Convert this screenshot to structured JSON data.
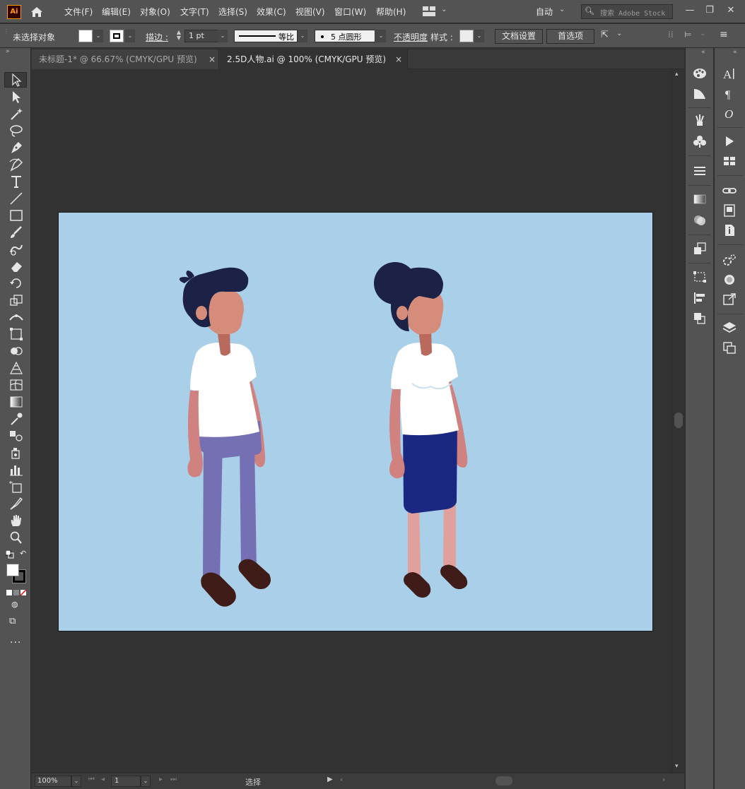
{
  "app": {
    "logo_text": "Ai",
    "menu": [
      "文件(F)",
      "编辑(E)",
      "对象(O)",
      "文字(T)",
      "选择(S)",
      "效果(C)",
      "视图(V)",
      "窗口(W)",
      "帮助(H)"
    ],
    "workspace": "自动",
    "search_placeholder": "搜索 Adobe Stock"
  },
  "control_bar": {
    "selection_status": "未选择对象",
    "stroke_label": "描边 :",
    "stroke_weight": "1 pt",
    "stroke_profile": "等比",
    "brush": "5 点圆形",
    "opacity_label": "不透明度",
    "style_label": "样式 :",
    "doc_setup_button": "文档设置",
    "preferences_button": "首选项",
    "fill_color": "#ffffff",
    "stroke_color": "#000000"
  },
  "tabs": [
    {
      "label": "未标题-1* @ 66.67% (CMYK/GPU 预览)",
      "active": false
    },
    {
      "label": "2.5D人物.ai @ 100% (CMYK/GPU 预览)",
      "active": true
    }
  ],
  "status_bar": {
    "zoom": "100%",
    "artboard_number": "1",
    "tool_status": "选择"
  },
  "colors": {
    "artboard_bg": "#a9cfe9",
    "hair": "#1c2146",
    "skin": "#d58c7a",
    "skin_dark": "#b96a5d",
    "arm": "#cf8280",
    "leg_woman": "#e0a09c",
    "shirt": "#ffffff",
    "pants": "#7470b3",
    "skirt": "#1a2882",
    "shoes": "#3f1c17"
  }
}
